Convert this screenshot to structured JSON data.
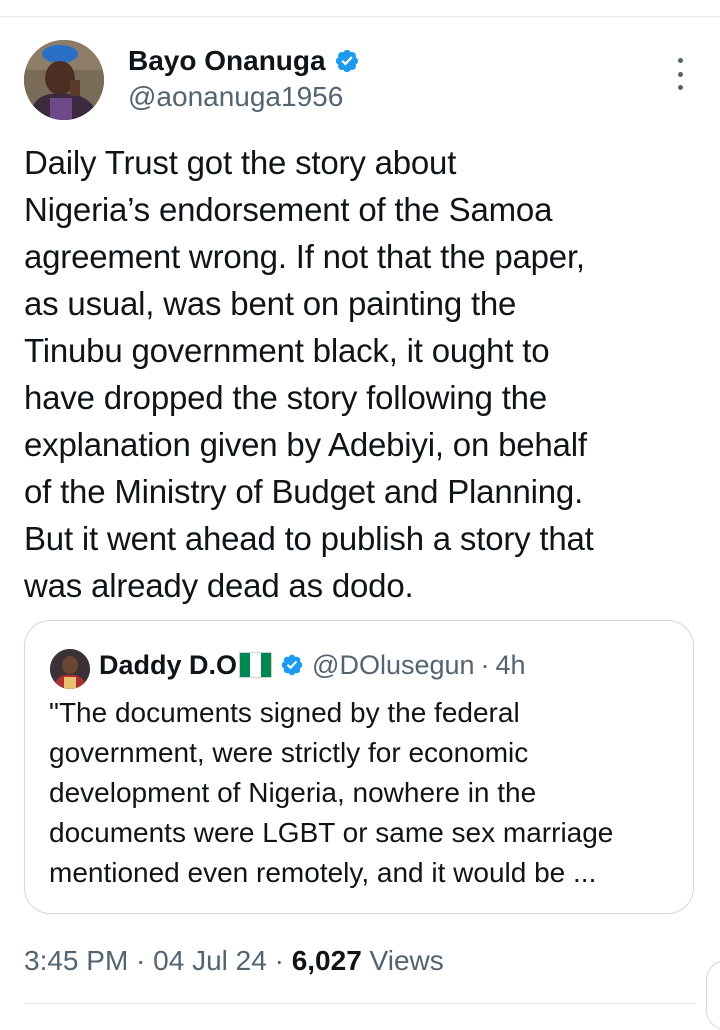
{
  "tweet": {
    "author": {
      "name": "Bayo Onanuga",
      "handle": "@aonanuga1956",
      "avatar_icon": "profile-photo",
      "verified_icon": "verified-badge-icon"
    },
    "more_icon": "more-vertical-icon",
    "text_lines": [
      "Daily Trust got the story about",
      "Nigeria’s endorsement of the Samoa",
      "agreement wrong. If not that the paper,",
      "as usual, was bent on painting the",
      "Tinubu government black, it ought to",
      "have dropped the story following the",
      "explanation given by Adebiyi, on behalf",
      "of the Ministry of Budget and Planning.",
      "But it went ahead to publish a story that",
      "was already dead as dodo."
    ],
    "quote": {
      "name": "Daddy D.O",
      "flag_icon": "nigeria-flag-icon",
      "handle": "@DOlusegun",
      "separator": "·",
      "time": "4h",
      "text_lines": [
        "\"The documents signed by the federal",
        "government, were strictly for economic",
        "development of Nigeria, nowhere in the",
        "documents were LGBT or same sex marriage",
        "mentioned even remotely, and it would be ..."
      ]
    },
    "meta": {
      "time": "3:45 PM",
      "sep1": " · ",
      "date": "04 Jul 24",
      "sep2": " · ",
      "views_count": "6,027",
      "views_label": " Views"
    }
  },
  "colors": {
    "text_primary": "#0f1419",
    "text_secondary": "#536471",
    "verified_blue": "#1d9bf0",
    "border": "#cfd9de",
    "flag_green": "#008751"
  }
}
